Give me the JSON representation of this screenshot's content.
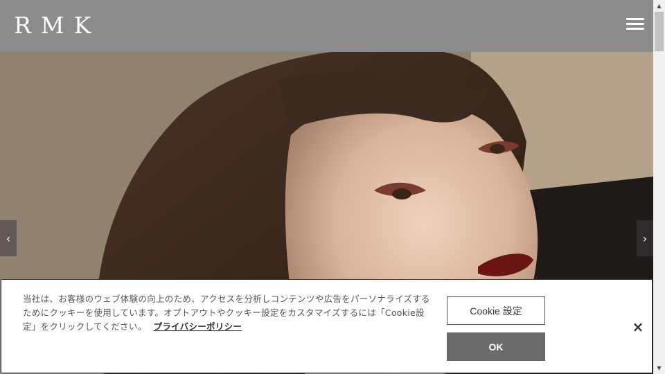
{
  "header": {
    "logo_text": "RMK",
    "menu_icon": "hamburger-menu-icon",
    "background": "#8c8c8c"
  },
  "hero": {
    "prev_icon": "‹",
    "next_icon": "›"
  },
  "cookie_banner": {
    "text": "当社は、お客様のウェブ体験の向上のため、アクセスを分析しコンテンツや広告をパーソナライズするためにクッキーを使用しています。オプトアウトやクッキー設定をカスタマイズするには「Cookie設定」をクリックしてください。",
    "privacy_link": "プライバシーポリシー",
    "settings_label": "Cookie 設定",
    "ok_label": "OK",
    "close_icon": "×",
    "ok_color": "#6b6b6b"
  },
  "scrollbar": {
    "up_icon": "▲",
    "down_icon": "▼"
  }
}
